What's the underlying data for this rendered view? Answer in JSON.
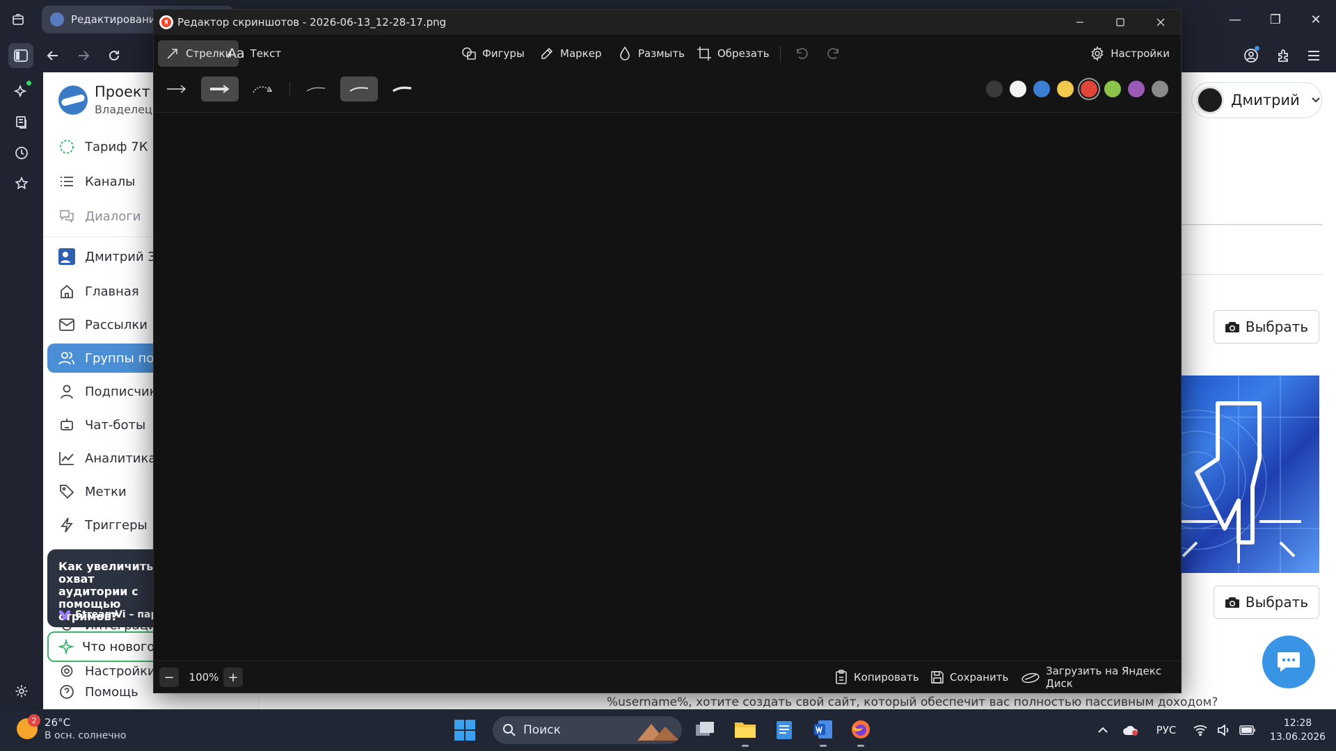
{
  "browser": {
    "active_tab_title": "Редактирование г",
    "window_controls": {
      "minimize": "—",
      "restore": "❐",
      "close": "✕"
    }
  },
  "site": {
    "project_title": "Проект I",
    "project_subtitle": "Владелец",
    "nav": {
      "tariff": "Тариф 7К",
      "channels": "Каналы",
      "dialogs": "Диалоги",
      "account": "Дмитрий Зн",
      "home": "Главная",
      "mailings": "Рассылки",
      "groups": "Группы под",
      "subscribers": "Подписчики",
      "chatbots": "Чат-боты",
      "analytics": "Аналитика",
      "tags": "Метки",
      "triggers": "Триггеры",
      "integrations": "Интеграции",
      "settings": "Настройки",
      "help": "Помощь"
    },
    "promo": {
      "text": "Как увеличить охват аудитории с помощью стримов?",
      "brand": "StreamVi – пар"
    },
    "whats_new": "Что нового -",
    "user_name": "Дмитрий",
    "select_button_1": "Выбрать",
    "select_button_2": "Выбрать",
    "footer_message": "%username%, хотите создать свой сайт, который обеспечит вас полностью пассивным доходом?"
  },
  "editor": {
    "window_title": "Редактор скриншотов - 2026-06-13_12-28-17.png",
    "tools": {
      "arrows": "Стрелки",
      "text": "Текст",
      "text_glyph": "Aa",
      "shapes": "Фигуры",
      "marker": "Маркер",
      "blur": "Размыть",
      "crop": "Обрезать",
      "settings": "Настройки"
    },
    "active_tool": "arrows",
    "arrow_styles": [
      "thin-arrow",
      "thick-arrow",
      "dotted-arrow"
    ],
    "active_arrow_style": "thick-arrow",
    "stroke_widths": [
      "thin",
      "medium",
      "thick"
    ],
    "active_stroke_width": "medium",
    "palette": [
      "#3a3a3a",
      "#f2f2f2",
      "#3b7fd4",
      "#f2c94c",
      "#e0453a",
      "#8bc34a",
      "#9b59b6",
      "#8a8a8a"
    ],
    "selected_color": "#e0453a",
    "zoom": {
      "minus": "−",
      "value": "100%",
      "plus": "+"
    },
    "actions": {
      "copy": "Копировать",
      "save": "Сохранить",
      "upload": "Загрузить на Яндекс Диск"
    }
  },
  "taskbar": {
    "weather_badge": "2",
    "temperature": "26°C",
    "weather_desc": "В осн. солнечно",
    "search_placeholder": "Поиск",
    "language": "РУС",
    "time": "12:28",
    "date": "13.06.2026"
  }
}
